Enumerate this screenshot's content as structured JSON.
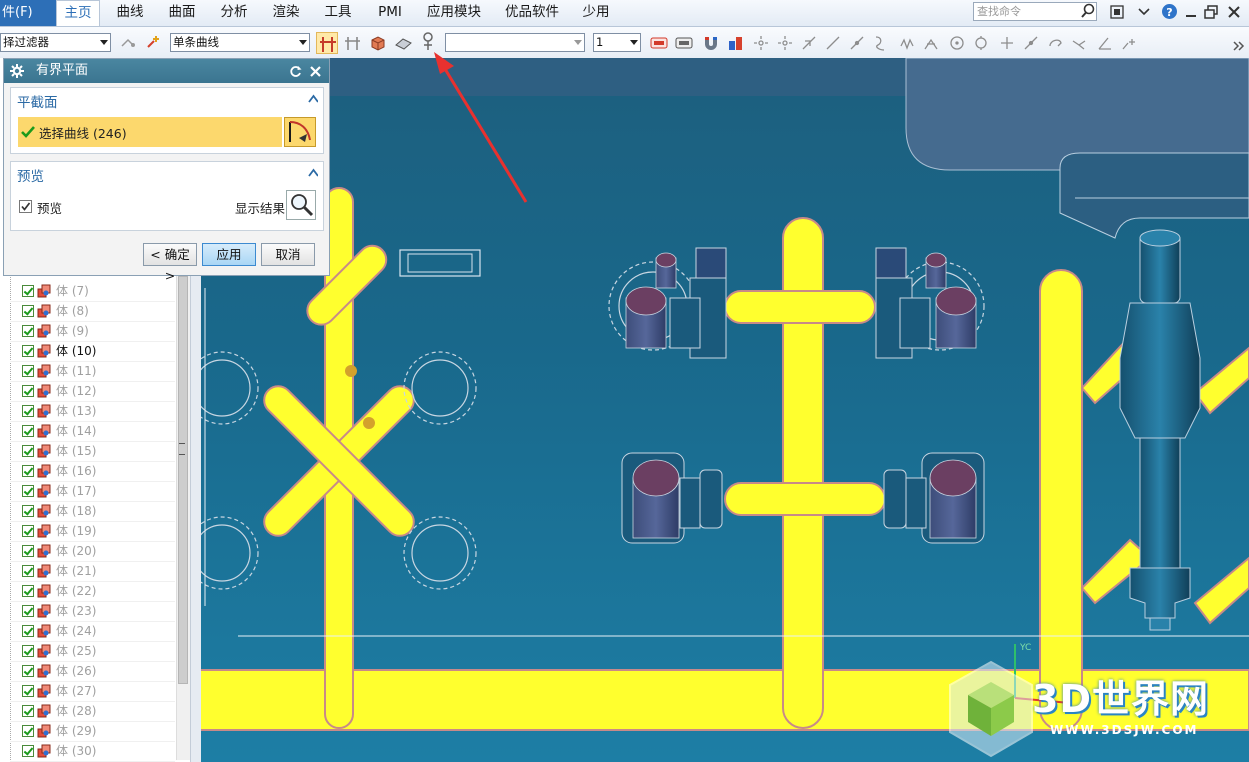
{
  "menubar": {
    "file_label": "件(F)",
    "items": [
      "主页",
      "曲线",
      "曲面",
      "分析",
      "渲染",
      "工具",
      "PMI",
      "应用模块",
      "优品软件",
      "少用"
    ],
    "active_index": 0,
    "search_placeholder": "查找命令"
  },
  "toolbar": {
    "filter_value": "择过滤器",
    "curve_rule_value": "单条曲线",
    "empty_combo_value": "",
    "count_value": "1",
    "icons": [
      "snap-icon",
      "snap-plus-icon",
      "stop-at-intersection-icon",
      "follow-fillet-icon",
      "solid-icon",
      "face-icon",
      "feature-icon",
      "color-a-icon",
      "color-b-icon",
      "magnet-icon",
      "cube-color-icon",
      "point-icon",
      "point-center-icon",
      "point-on-curve-icon",
      "line-icon",
      "arc-icon",
      "spline-icon",
      "curve-icon",
      "intersection-icon",
      "circle-icon",
      "circle-center-icon",
      "plus-icon",
      "tangent-icon",
      "rotate-icon",
      "line-break-icon",
      "angle-icon",
      "grid-icon"
    ]
  },
  "dialog": {
    "title": "有界平面",
    "section1_title": "平截面",
    "select_label": "选择曲线 (246)",
    "section2_title": "预览",
    "preview_label": "预览",
    "show_result_label": "显示结果",
    "ok_label": "< 确定 >",
    "apply_label": "应用",
    "cancel_label": "取消"
  },
  "navigator": {
    "rows": [
      {
        "label": "体 (7)",
        "active": false
      },
      {
        "label": "体 (8)",
        "active": false
      },
      {
        "label": "体 (9)",
        "active": false
      },
      {
        "label": "体 (10)",
        "active": true
      },
      {
        "label": "体 (11)",
        "active": false
      },
      {
        "label": "体 (12)",
        "active": false
      },
      {
        "label": "体 (13)",
        "active": false
      },
      {
        "label": "体 (14)",
        "active": false
      },
      {
        "label": "体 (15)",
        "active": false
      },
      {
        "label": "体 (16)",
        "active": false
      },
      {
        "label": "体 (17)",
        "active": false
      },
      {
        "label": "体 (18)",
        "active": false
      },
      {
        "label": "体 (19)",
        "active": false
      },
      {
        "label": "体 (20)",
        "active": false
      },
      {
        "label": "体 (21)",
        "active": false
      },
      {
        "label": "体 (22)",
        "active": false
      },
      {
        "label": "体 (23)",
        "active": false
      },
      {
        "label": "体 (24)",
        "active": false
      },
      {
        "label": "体 (25)",
        "active": false
      },
      {
        "label": "体 (26)",
        "active": false
      },
      {
        "label": "体 (27)",
        "active": false
      },
      {
        "label": "体 (28)",
        "active": false
      },
      {
        "label": "体 (29)",
        "active": false
      },
      {
        "label": "体 (30)",
        "active": false
      }
    ]
  },
  "viewport": {
    "axis_label": "YC"
  },
  "watermark": {
    "title": "3D世界网",
    "url": "WWW.3DSJW.COM"
  },
  "colors": {
    "highlight_yellow": "#ffff2e",
    "viewport_bg": "#1b6e8e",
    "dialog_title_bg": "#3b7590",
    "selection_bg": "#fcd86d",
    "annotation_arrow": "#e8312f"
  }
}
